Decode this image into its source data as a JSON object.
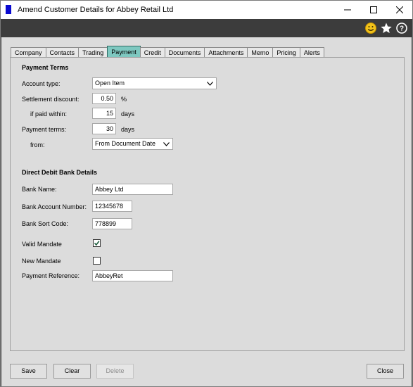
{
  "window": {
    "title": "Amend Customer Details for Abbey Retail Ltd",
    "controls": {
      "minimize": "—",
      "maximize": "☐",
      "close": "✕"
    }
  },
  "toolbar": {
    "icons": [
      "smiley-icon",
      "star-icon",
      "help-icon"
    ]
  },
  "tabs": [
    {
      "label": "Company"
    },
    {
      "label": "Contacts"
    },
    {
      "label": "Trading"
    },
    {
      "label": "Payment",
      "active": true
    },
    {
      "label": "Credit"
    },
    {
      "label": "Documents"
    },
    {
      "label": "Attachments"
    },
    {
      "label": "Memo"
    },
    {
      "label": "Pricing"
    },
    {
      "label": "Alerts"
    }
  ],
  "payment_terms": {
    "heading": "Payment Terms",
    "account_type_label": "Account type:",
    "account_type_value": "Open Item",
    "settlement_discount_label": "Settlement discount:",
    "settlement_discount_value": "0.50",
    "settlement_discount_unit": "%",
    "if_paid_within_label": "if paid within:",
    "if_paid_within_value": "15",
    "if_paid_within_unit": "days",
    "payment_terms_label": "Payment terms:",
    "payment_terms_value": "30",
    "payment_terms_unit": "days",
    "from_label": "from:",
    "from_value": "From Document Date"
  },
  "direct_debit": {
    "heading": "Direct Debit Bank Details",
    "bank_name_label": "Bank Name:",
    "bank_name_value": "Abbey Ltd",
    "account_number_label": "Bank Account Number:",
    "account_number_value": "12345678",
    "sort_code_label": "Bank Sort Code:",
    "sort_code_value": "778899",
    "valid_mandate_label": "Valid Mandate",
    "valid_mandate_checked": true,
    "new_mandate_label": "New Mandate",
    "new_mandate_checked": false,
    "payment_reference_label": "Payment Reference:",
    "payment_reference_value": "AbbeyRet"
  },
  "footer": {
    "save": "Save",
    "clear": "Clear",
    "delete": "Delete",
    "close": "Close"
  },
  "colors": {
    "active_tab": "#7ec8c0",
    "titlebar_icon": "#0a0ad0",
    "smiley": "#f2c31b"
  }
}
